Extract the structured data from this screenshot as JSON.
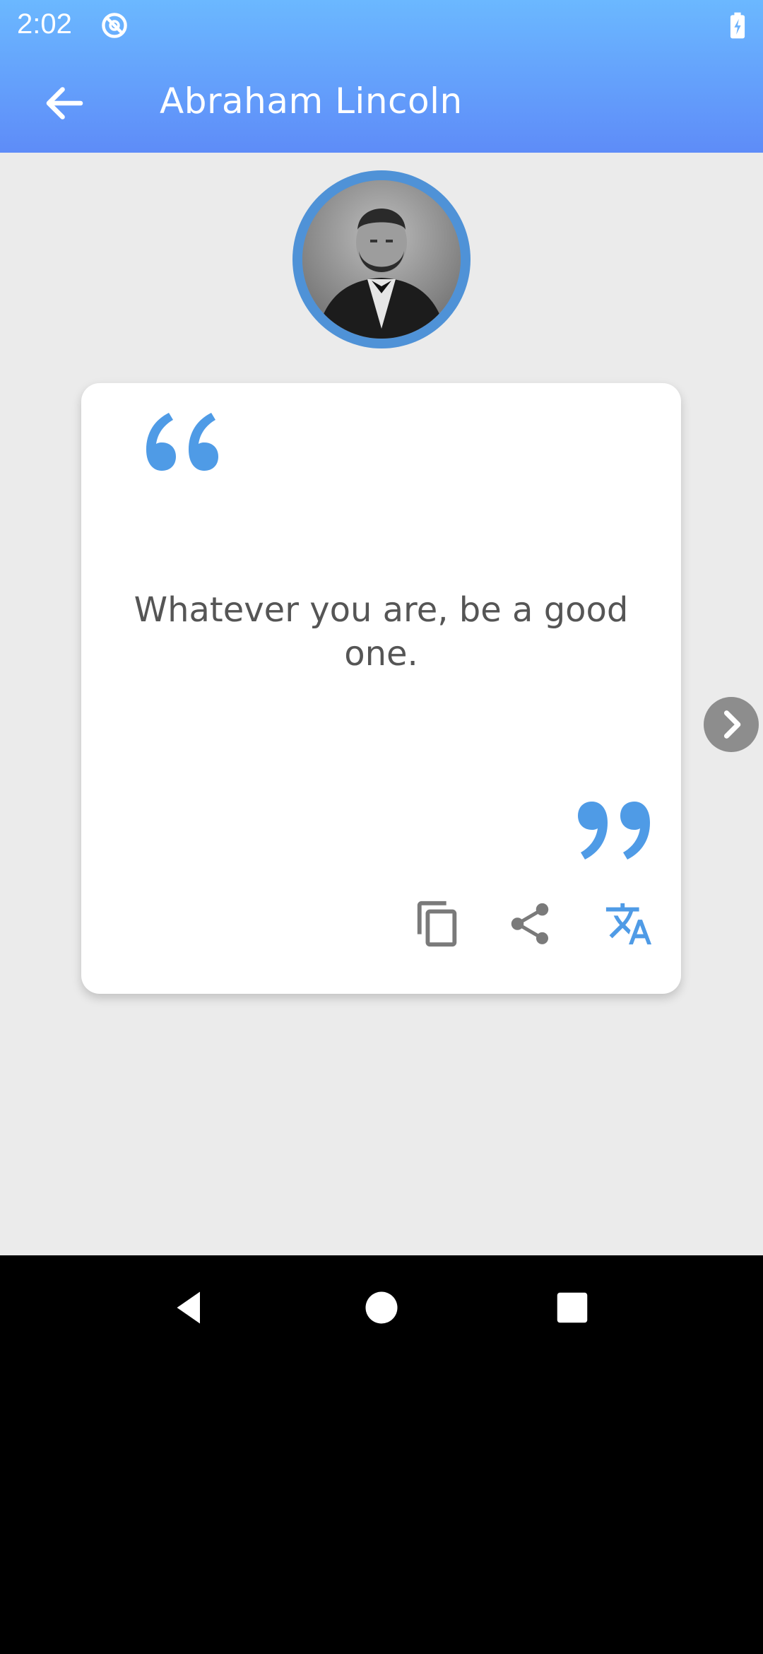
{
  "status_bar": {
    "time": "2:02",
    "icons": [
      "data-saver-icon",
      "battery-charging-icon"
    ]
  },
  "toolbar": {
    "title": "Abraham Lincoln",
    "back_icon": "arrow-left-icon"
  },
  "author": {
    "avatar_alt": "Abraham Lincoln"
  },
  "quote": {
    "text": "Whatever you are, be a good one."
  },
  "actions": [
    {
      "name": "copy",
      "icon": "copy-icon"
    },
    {
      "name": "share",
      "icon": "share-icon"
    },
    {
      "name": "translate",
      "icon": "translate-icon"
    }
  ],
  "navigation": {
    "next_icon": "chevron-right-icon"
  },
  "colors": {
    "appbar_top": "#6bb8ff",
    "appbar_bottom": "#5e8cf8",
    "accent": "#4f9be6",
    "background": "#ebebeb",
    "text": "#555555",
    "icon_gray": "#7a7a7a"
  },
  "system_nav": [
    "back-icon",
    "home-icon",
    "recents-icon"
  ]
}
